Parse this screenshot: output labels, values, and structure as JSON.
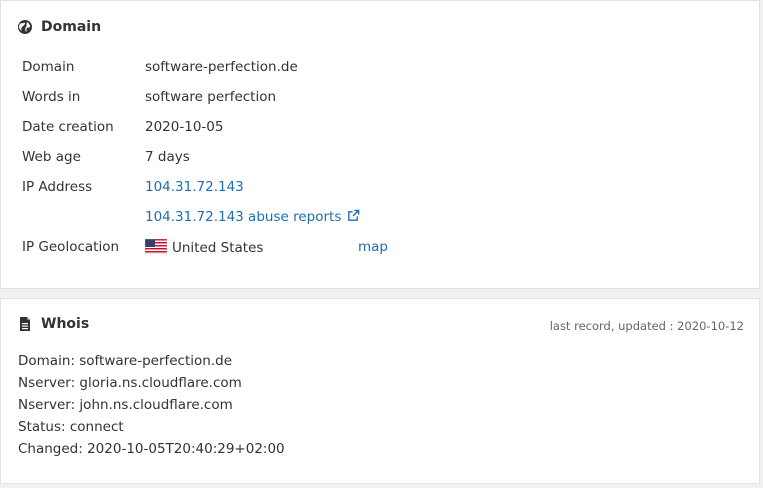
{
  "domain_section": {
    "title": "Domain",
    "icon": "globe-icon",
    "rows": {
      "domain": {
        "label": "Domain",
        "value": "software-perfection.de"
      },
      "words": {
        "label": "Words in",
        "value": "software perfection"
      },
      "date_creation": {
        "label": "Date creation",
        "value": "2020-10-05"
      },
      "web_age": {
        "label": "Web age",
        "value": "7 days"
      },
      "ip_address": {
        "label": "IP Address",
        "value": "104.31.72.143"
      },
      "abuse": {
        "value": "104.31.72.143 abuse reports"
      },
      "geolocation": {
        "label": "IP Geolocation",
        "value": "United States",
        "map": "map"
      }
    }
  },
  "whois_section": {
    "title": "Whois",
    "icon": "document-icon",
    "updated": "last record, updated : 2020-10-12",
    "lines": [
      "Domain: software-perfection.de",
      "Nserver: gloria.ns.cloudflare.com",
      "Nserver: john.ns.cloudflare.com",
      "Status: connect",
      "Changed: 2020-10-05T20:40:29+02:00"
    ]
  },
  "colors": {
    "link": "#1f6db5",
    "text": "#333333",
    "background": "#f1f1f1"
  }
}
